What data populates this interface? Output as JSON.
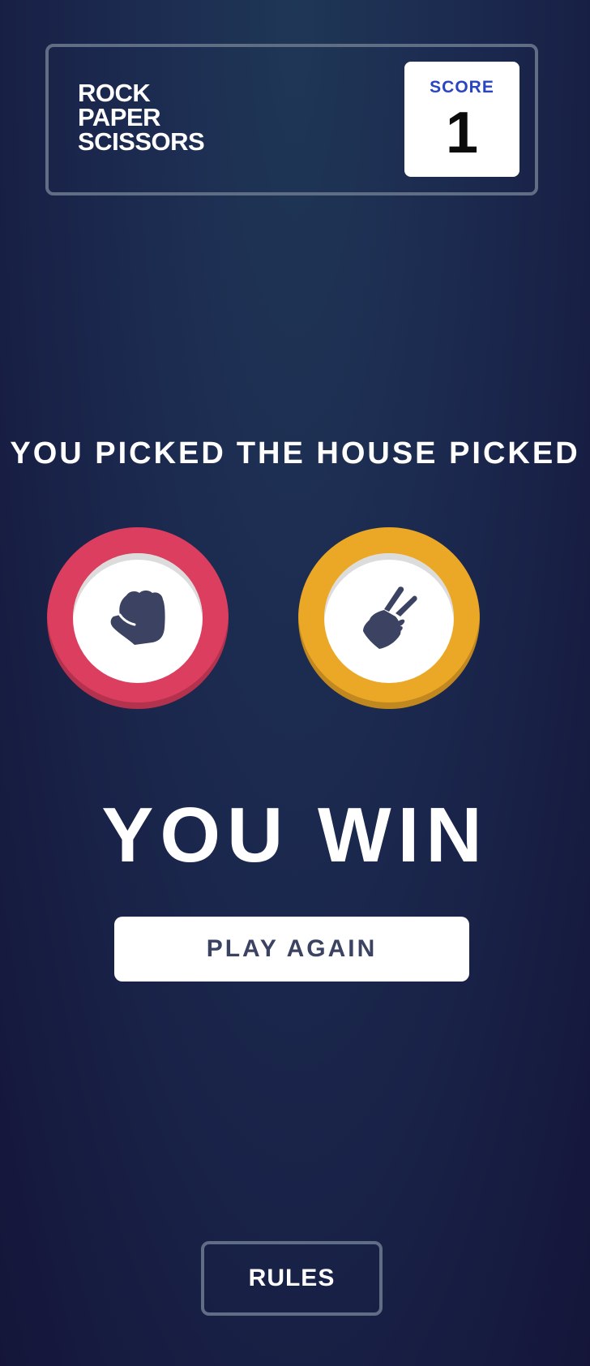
{
  "header": {
    "title_lines": [
      "ROCK",
      "PAPER",
      "SCISSORS"
    ],
    "score_label": "SCORE",
    "score_value": "1"
  },
  "picks": {
    "you_label": "YOU PICKED",
    "house_label": "THE HOUSE PICKED",
    "you": {
      "choice": "rock",
      "icon": "rock-hand-icon",
      "ring_color": "#dc3e5f"
    },
    "house": {
      "choice": "scissors",
      "icon": "scissors-hand-icon",
      "ring_color": "#eba726"
    }
  },
  "result": {
    "text": "YOU WIN",
    "play_again_label": "PLAY AGAIN"
  },
  "footer": {
    "rules_label": "RULES"
  },
  "colors": {
    "icon": "#3b4262",
    "score_label": "#2a45c2",
    "header_border": "#606e85"
  }
}
